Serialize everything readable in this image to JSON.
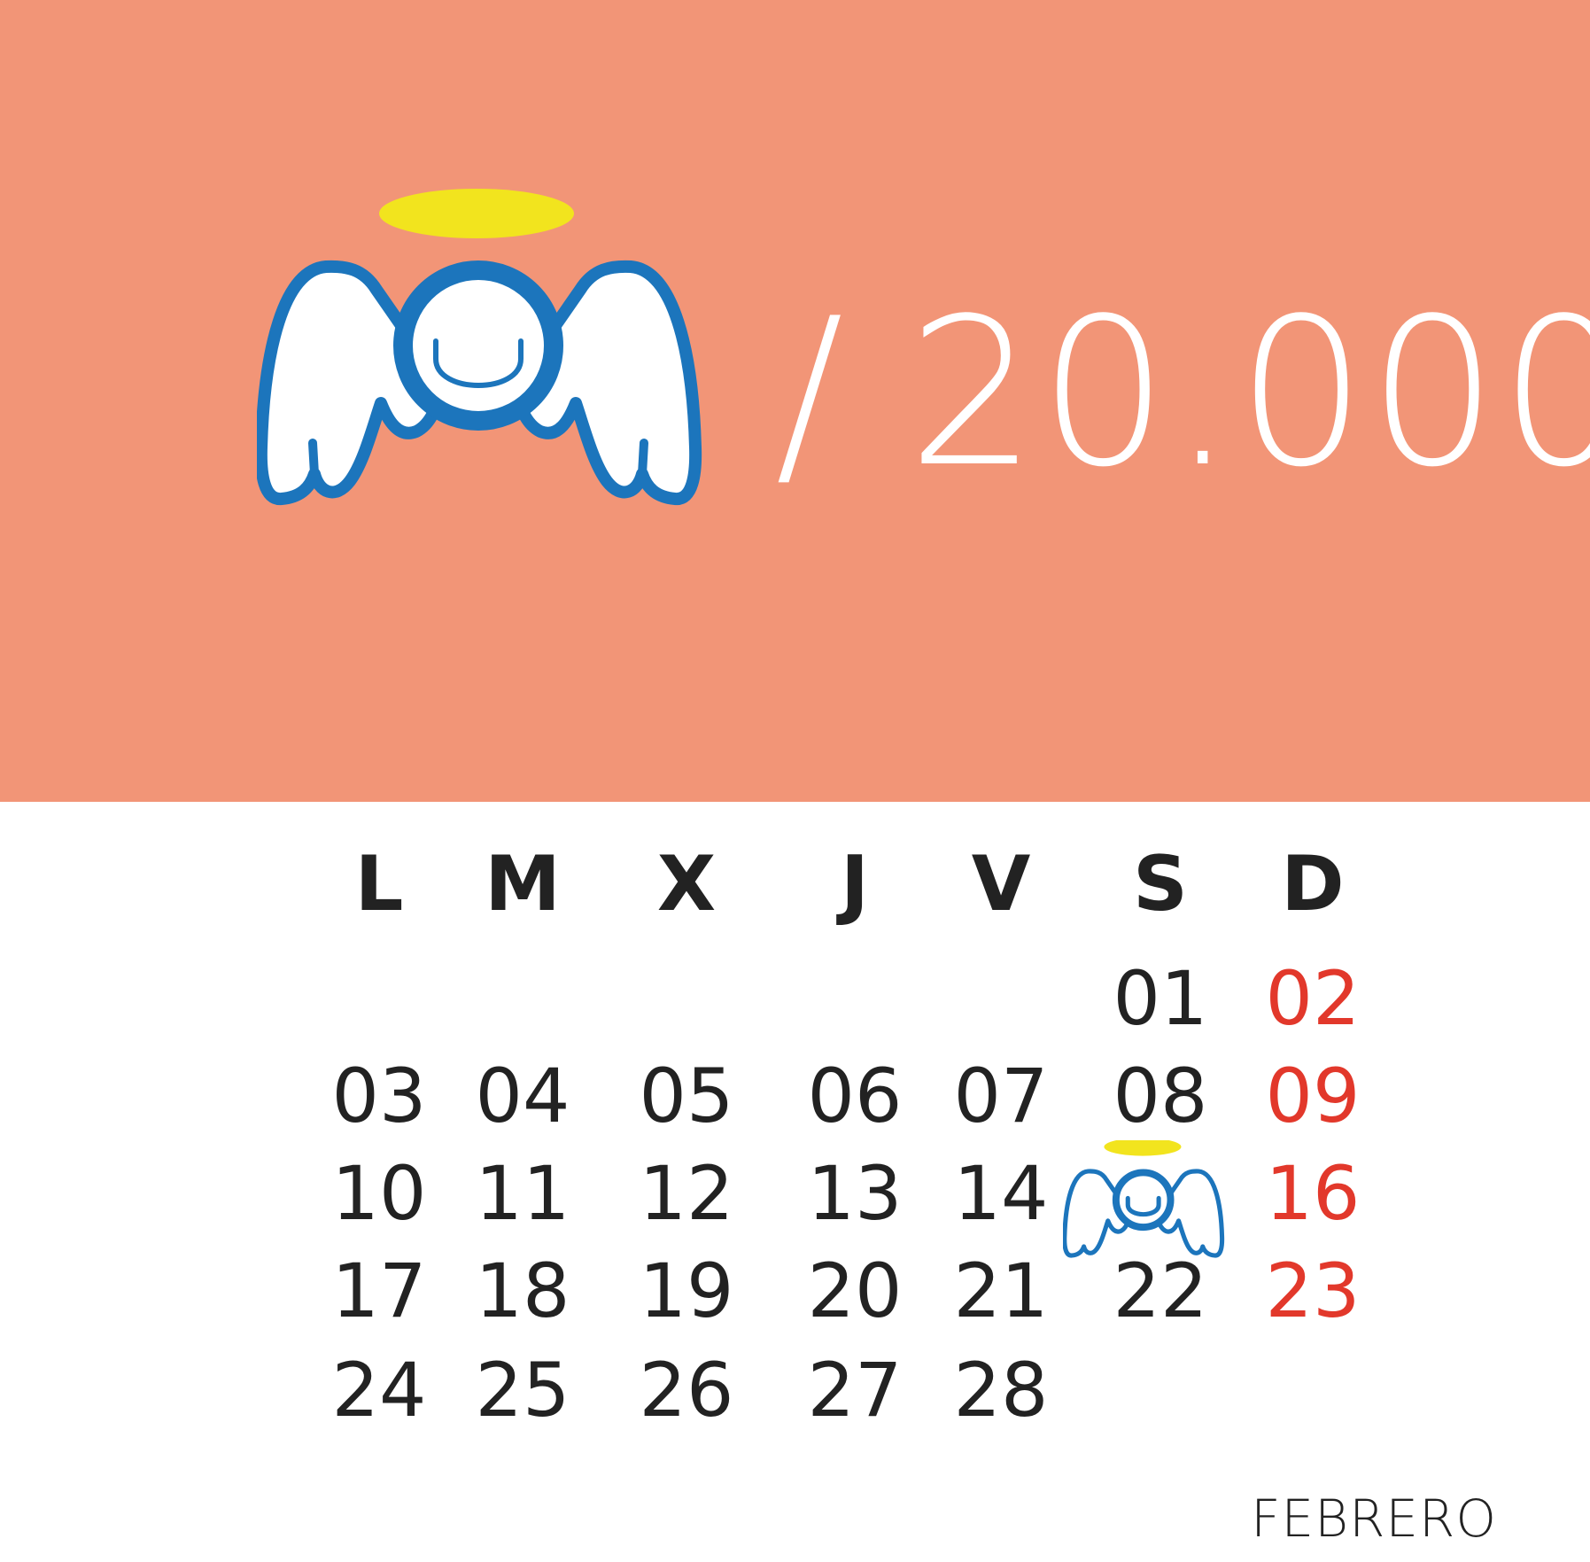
{
  "colors": {
    "hero_bg": "#F29577",
    "hero_text": "#ffffff",
    "angel_blue": "#1C75BC",
    "halo_yellow": "#F2E41E",
    "weekday_text": "#222222",
    "sunday_text": "#E2382B"
  },
  "hero": {
    "icon": "angel-icon",
    "slash": "/",
    "count": "20.000"
  },
  "calendar": {
    "month": "FEBRERO",
    "weekdays": [
      "L",
      "M",
      "X",
      "J",
      "V",
      "S",
      "D"
    ],
    "highlighted_day_icon": "angel-icon",
    "rows": [
      [
        "",
        "",
        "",
        "",
        "",
        "01",
        "02"
      ],
      [
        "03",
        "04",
        "05",
        "06",
        "07",
        "08",
        "09"
      ],
      [
        "10",
        "11",
        "12",
        "13",
        "14",
        "",
        "16"
      ],
      [
        "17",
        "18",
        "19",
        "20",
        "21",
        "22",
        "23"
      ],
      [
        "24",
        "25",
        "26",
        "27",
        "28",
        "",
        ""
      ]
    ]
  }
}
